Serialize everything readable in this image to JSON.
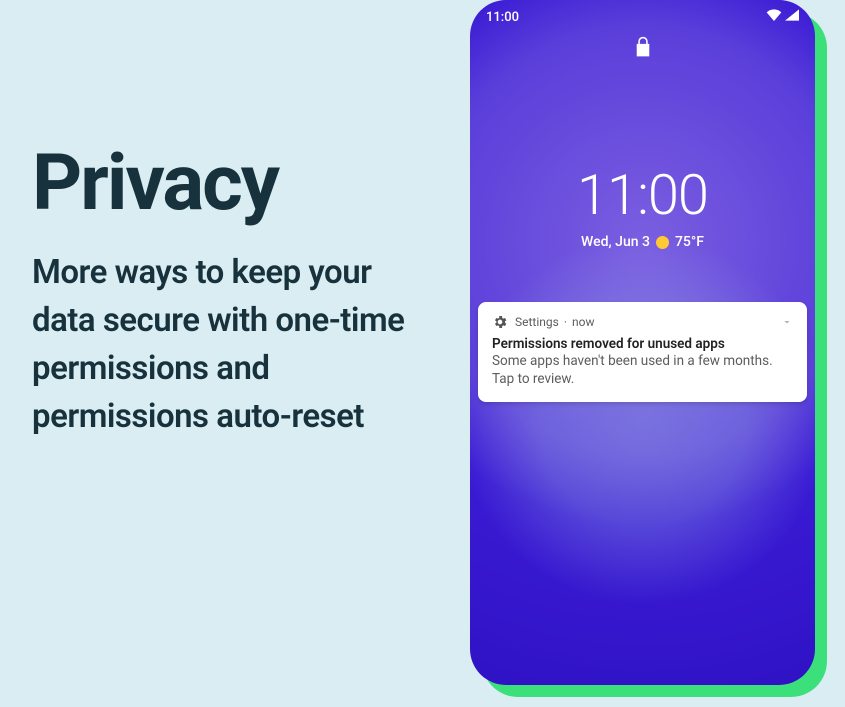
{
  "headline": "Privacy",
  "subhead": "More ways to keep your data secure with one-time permissions and permissions auto-reset",
  "phone": {
    "status_time": "11:00",
    "clock_time": "11:00",
    "clock_date": "Wed, Jun 3",
    "weather_temp": "75°F"
  },
  "notification": {
    "app": "Settings",
    "posted": "now",
    "title": "Permissions removed for unused apps",
    "body": "Some apps haven't been used in a few months. Tap to review."
  }
}
